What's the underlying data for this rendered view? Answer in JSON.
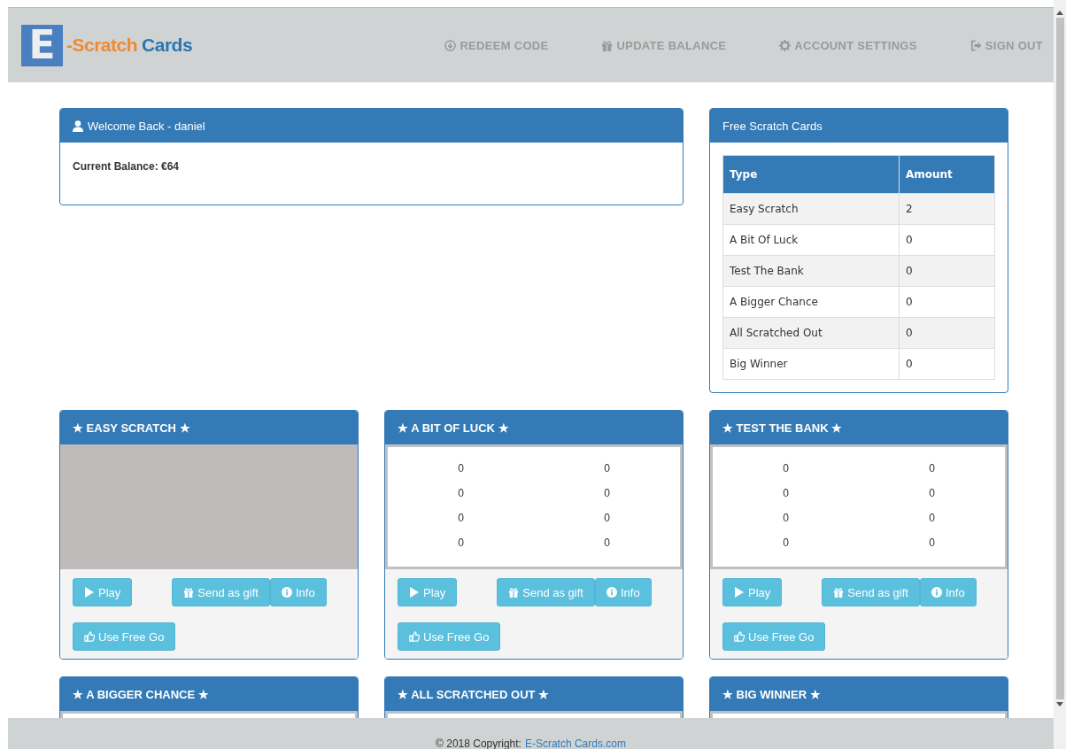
{
  "logo": {
    "letter": "E",
    "word_1": "-Scratch",
    "word_2": "Cards"
  },
  "nav": [
    {
      "label": "REDEEM CODE",
      "kind": "download"
    },
    {
      "label": "UPDATE BALANCE",
      "kind": "gift"
    },
    {
      "label": "ACCOUNT SETTINGS",
      "kind": "gear"
    },
    {
      "label": "SIGN OUT",
      "kind": "signout"
    }
  ],
  "welcome": {
    "title": "Welcome Back - daniel",
    "balance": "Current Balance: €64"
  },
  "free_cards": {
    "title": "Free Scratch Cards",
    "columns": [
      "Type",
      "Amount"
    ],
    "rows": [
      [
        "Easy Scratch",
        "2"
      ],
      [
        "A Bit Of Luck",
        "0"
      ],
      [
        "Test The Bank",
        "0"
      ],
      [
        "A Bigger Chance",
        "0"
      ],
      [
        "All Scratched Out",
        "0"
      ],
      [
        "Big Winner",
        "0"
      ]
    ]
  },
  "cards": [
    {
      "title": "★ EASY SCRATCH ★",
      "kind": "scratch",
      "buttons": [
        "Play",
        "Send as gift",
        "Info",
        "Use Free Go"
      ]
    },
    {
      "title": "★ A BIT OF LUCK ★",
      "kind": "grid",
      "cells": [
        "0",
        "0",
        "0",
        "0",
        "0",
        "0",
        "0",
        "0"
      ],
      "buttons": [
        "Play",
        "Send as gift",
        "Info",
        "Use Free Go"
      ]
    },
    {
      "title": "★ TEST THE BANK ★",
      "kind": "grid",
      "cells": [
        "0",
        "0",
        "0",
        "0",
        "0",
        "0",
        "0",
        "0"
      ],
      "buttons": [
        "Play",
        "Send as gift",
        "Info",
        "Use Free Go"
      ]
    },
    {
      "title": "★ A BIGGER CHANCE ★",
      "kind": "cut"
    },
    {
      "title": "★ ALL SCRATCHED OUT ★",
      "kind": "cut"
    },
    {
      "title": "★ BIG WINNER ★",
      "kind": "cut"
    }
  ],
  "footer": {
    "text": "© 2018 Copyright:",
    "link": "E-Scratch Cards.com"
  }
}
